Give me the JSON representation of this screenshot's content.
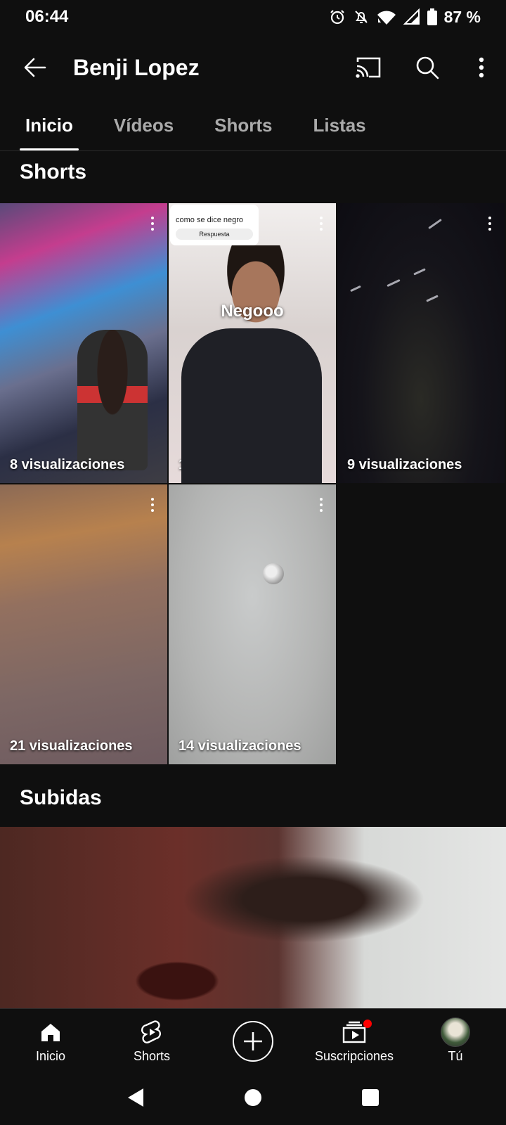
{
  "status_bar": {
    "time": "06:44",
    "battery": "87 %"
  },
  "header": {
    "channel_name": "Benji Lopez"
  },
  "tabs": [
    {
      "label": "Inicio",
      "active": true
    },
    {
      "label": "Vídeos",
      "active": false
    },
    {
      "label": "Shorts",
      "active": false
    },
    {
      "label": "Listas",
      "active": false
    }
  ],
  "shorts_section": {
    "title": "Shorts",
    "items": [
      {
        "views": "8 visualizaciones"
      },
      {
        "views": "14 visualizaciones",
        "overlay_title": "Negooo",
        "comment_question": "como se dice negro",
        "comment_reply": "Respuesta"
      },
      {
        "views": "9 visualizaciones"
      },
      {
        "views": "21 visualizaciones"
      },
      {
        "views": "14 visualizaciones"
      }
    ]
  },
  "uploads_section": {
    "title": "Subidas"
  },
  "bottom_nav": {
    "items": [
      {
        "label": "Inicio",
        "icon": "home-icon"
      },
      {
        "label": "Shorts",
        "icon": "shorts-icon"
      },
      {
        "label": "",
        "icon": "create-icon"
      },
      {
        "label": "Suscripciones",
        "icon": "subscriptions-icon"
      },
      {
        "label": "Tú",
        "icon": "avatar"
      }
    ]
  },
  "colors": {
    "background": "#0f0f0f",
    "notification_dot": "#ff0000",
    "inactive_tab": "#aaaaaa"
  }
}
